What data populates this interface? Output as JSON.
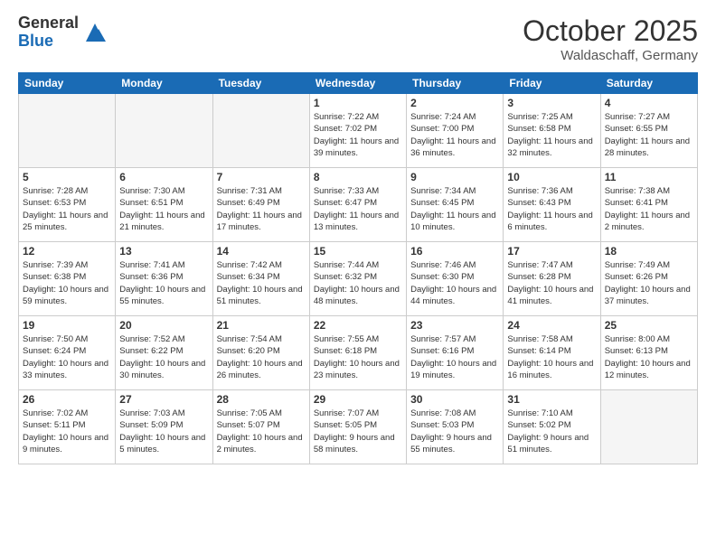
{
  "logo": {
    "general": "General",
    "blue": "Blue"
  },
  "header": {
    "month": "October 2025",
    "location": "Waldaschaff, Germany"
  },
  "weekdays": [
    "Sunday",
    "Monday",
    "Tuesday",
    "Wednesday",
    "Thursday",
    "Friday",
    "Saturday"
  ],
  "weeks": [
    [
      {
        "day": "",
        "info": ""
      },
      {
        "day": "",
        "info": ""
      },
      {
        "day": "",
        "info": ""
      },
      {
        "day": "1",
        "info": "Sunrise: 7:22 AM\nSunset: 7:02 PM\nDaylight: 11 hours\nand 39 minutes."
      },
      {
        "day": "2",
        "info": "Sunrise: 7:24 AM\nSunset: 7:00 PM\nDaylight: 11 hours\nand 36 minutes."
      },
      {
        "day": "3",
        "info": "Sunrise: 7:25 AM\nSunset: 6:58 PM\nDaylight: 11 hours\nand 32 minutes."
      },
      {
        "day": "4",
        "info": "Sunrise: 7:27 AM\nSunset: 6:55 PM\nDaylight: 11 hours\nand 28 minutes."
      }
    ],
    [
      {
        "day": "5",
        "info": "Sunrise: 7:28 AM\nSunset: 6:53 PM\nDaylight: 11 hours\nand 25 minutes."
      },
      {
        "day": "6",
        "info": "Sunrise: 7:30 AM\nSunset: 6:51 PM\nDaylight: 11 hours\nand 21 minutes."
      },
      {
        "day": "7",
        "info": "Sunrise: 7:31 AM\nSunset: 6:49 PM\nDaylight: 11 hours\nand 17 minutes."
      },
      {
        "day": "8",
        "info": "Sunrise: 7:33 AM\nSunset: 6:47 PM\nDaylight: 11 hours\nand 13 minutes."
      },
      {
        "day": "9",
        "info": "Sunrise: 7:34 AM\nSunset: 6:45 PM\nDaylight: 11 hours\nand 10 minutes."
      },
      {
        "day": "10",
        "info": "Sunrise: 7:36 AM\nSunset: 6:43 PM\nDaylight: 11 hours\nand 6 minutes."
      },
      {
        "day": "11",
        "info": "Sunrise: 7:38 AM\nSunset: 6:41 PM\nDaylight: 11 hours\nand 2 minutes."
      }
    ],
    [
      {
        "day": "12",
        "info": "Sunrise: 7:39 AM\nSunset: 6:38 PM\nDaylight: 10 hours\nand 59 minutes."
      },
      {
        "day": "13",
        "info": "Sunrise: 7:41 AM\nSunset: 6:36 PM\nDaylight: 10 hours\nand 55 minutes."
      },
      {
        "day": "14",
        "info": "Sunrise: 7:42 AM\nSunset: 6:34 PM\nDaylight: 10 hours\nand 51 minutes."
      },
      {
        "day": "15",
        "info": "Sunrise: 7:44 AM\nSunset: 6:32 PM\nDaylight: 10 hours\nand 48 minutes."
      },
      {
        "day": "16",
        "info": "Sunrise: 7:46 AM\nSunset: 6:30 PM\nDaylight: 10 hours\nand 44 minutes."
      },
      {
        "day": "17",
        "info": "Sunrise: 7:47 AM\nSunset: 6:28 PM\nDaylight: 10 hours\nand 41 minutes."
      },
      {
        "day": "18",
        "info": "Sunrise: 7:49 AM\nSunset: 6:26 PM\nDaylight: 10 hours\nand 37 minutes."
      }
    ],
    [
      {
        "day": "19",
        "info": "Sunrise: 7:50 AM\nSunset: 6:24 PM\nDaylight: 10 hours\nand 33 minutes."
      },
      {
        "day": "20",
        "info": "Sunrise: 7:52 AM\nSunset: 6:22 PM\nDaylight: 10 hours\nand 30 minutes."
      },
      {
        "day": "21",
        "info": "Sunrise: 7:54 AM\nSunset: 6:20 PM\nDaylight: 10 hours\nand 26 minutes."
      },
      {
        "day": "22",
        "info": "Sunrise: 7:55 AM\nSunset: 6:18 PM\nDaylight: 10 hours\nand 23 minutes."
      },
      {
        "day": "23",
        "info": "Sunrise: 7:57 AM\nSunset: 6:16 PM\nDaylight: 10 hours\nand 19 minutes."
      },
      {
        "day": "24",
        "info": "Sunrise: 7:58 AM\nSunset: 6:14 PM\nDaylight: 10 hours\nand 16 minutes."
      },
      {
        "day": "25",
        "info": "Sunrise: 8:00 AM\nSunset: 6:13 PM\nDaylight: 10 hours\nand 12 minutes."
      }
    ],
    [
      {
        "day": "26",
        "info": "Sunrise: 7:02 AM\nSunset: 5:11 PM\nDaylight: 10 hours\nand 9 minutes."
      },
      {
        "day": "27",
        "info": "Sunrise: 7:03 AM\nSunset: 5:09 PM\nDaylight: 10 hours\nand 5 minutes."
      },
      {
        "day": "28",
        "info": "Sunrise: 7:05 AM\nSunset: 5:07 PM\nDaylight: 10 hours\nand 2 minutes."
      },
      {
        "day": "29",
        "info": "Sunrise: 7:07 AM\nSunset: 5:05 PM\nDaylight: 9 hours\nand 58 minutes."
      },
      {
        "day": "30",
        "info": "Sunrise: 7:08 AM\nSunset: 5:03 PM\nDaylight: 9 hours\nand 55 minutes."
      },
      {
        "day": "31",
        "info": "Sunrise: 7:10 AM\nSunset: 5:02 PM\nDaylight: 9 hours\nand 51 minutes."
      },
      {
        "day": "",
        "info": ""
      }
    ]
  ]
}
